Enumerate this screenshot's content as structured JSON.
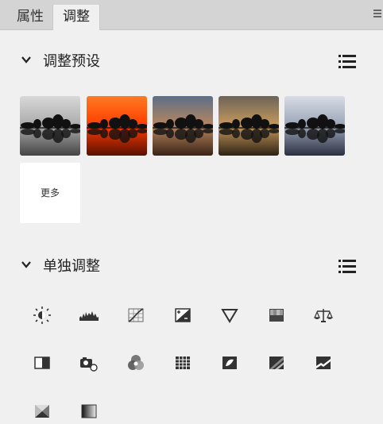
{
  "tabs": [
    {
      "label": "属性",
      "active": false
    },
    {
      "label": "调整",
      "active": true
    }
  ],
  "presets_section": {
    "title": "调整预设",
    "thumbnails": [
      "灰度",
      "日落",
      "暖色",
      "复古",
      "冷色"
    ],
    "more_label": "更多"
  },
  "individual_section": {
    "title": "单独调整",
    "row1": [
      "brightness-contrast-icon",
      "levels-icon",
      "curves-icon",
      "exposure-icon",
      "vibrance-icon",
      "hue-saturation-icon",
      "color-balance-icon"
    ],
    "row2": [
      "black-white-icon",
      "photo-filter-icon",
      "channel-mixer-icon",
      "color-lookup-icon",
      "invert-icon",
      "posterize-icon",
      "threshold-icon"
    ],
    "row3": [
      "selective-color-icon",
      "gradient-map-icon"
    ]
  },
  "colors": {
    "panel_bg": "#f0f0f0",
    "tab_bar": "#d4d4d4",
    "icon": "#333333"
  }
}
